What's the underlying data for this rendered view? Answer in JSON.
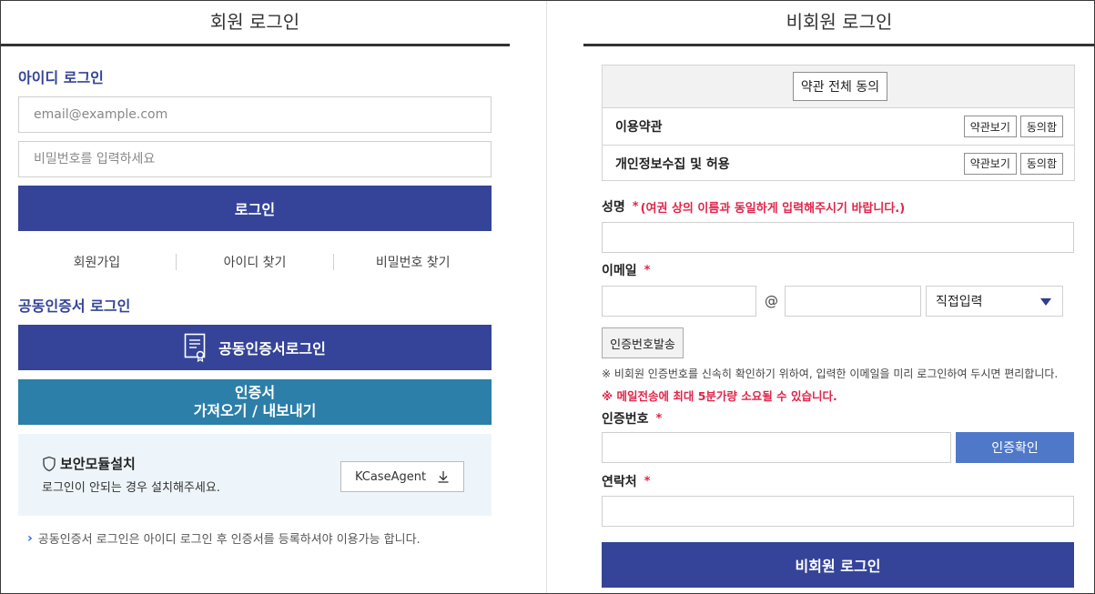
{
  "member": {
    "title": "회원 로그인",
    "id_login_heading": "아이디 로그인",
    "email_placeholder": "email@example.com",
    "password_placeholder": "비밀번호를 입력하세요",
    "login_button": "로그인",
    "links": {
      "signup": "회원가입",
      "find_id": "아이디 찾기",
      "find_password": "비밀번호 찾기"
    },
    "cert_heading": "공동인증서 로그인",
    "cert_login_button": "공동인증서로그인",
    "cert_transfer_line1": "인증서",
    "cert_transfer_line2": "가져오기 / 내보내기",
    "security": {
      "title": "보안모듈설치",
      "desc": "로그인이 안되는 경우 설치해주세요.",
      "button": "KCaseAgent"
    },
    "note": "공동인증서 로그인은 아이디 로그인 후 인증서를 등록하셔야 이용가능 합니다."
  },
  "guest": {
    "title": "비회원 로그인",
    "terms": {
      "agree_all": "약관 전체 동의",
      "rows": [
        {
          "label": "이용약관",
          "view": "약관보기",
          "agree": "동의함"
        },
        {
          "label": "개인정보수집 및 허용",
          "view": "약관보기",
          "agree": "동의함"
        }
      ]
    },
    "name_label": "성명",
    "required_mark": "*",
    "name_note": "(여권 상의 이름과 동일하게 입력해주시기 바랍니다.)",
    "email_label": "이메일",
    "at_sign": "@",
    "domain_select": "직접입력",
    "send_code_button": "인증번호발송",
    "info_note": "※ 비회원 인증번호를 신속히 확인하기 위하여, 입력한 이메일을 미리 로그인하여 두시면 편리합니다.",
    "warning_note": "※ 메일전송에 최대 5분가량 소요될 수 있습니다.",
    "code_label": "인증번호",
    "verify_button": "인증확인",
    "contact_label": "연락처",
    "guest_login_button": "비회원 로그인"
  },
  "colors": {
    "navy": "#354498",
    "teal": "#2b7fa8",
    "blue": "#4f78c9",
    "required": "#e0254a"
  },
  "icons": [
    "certificate-icon",
    "shield-icon",
    "download-icon",
    "chevron-right-icon",
    "caret-down-icon"
  ]
}
